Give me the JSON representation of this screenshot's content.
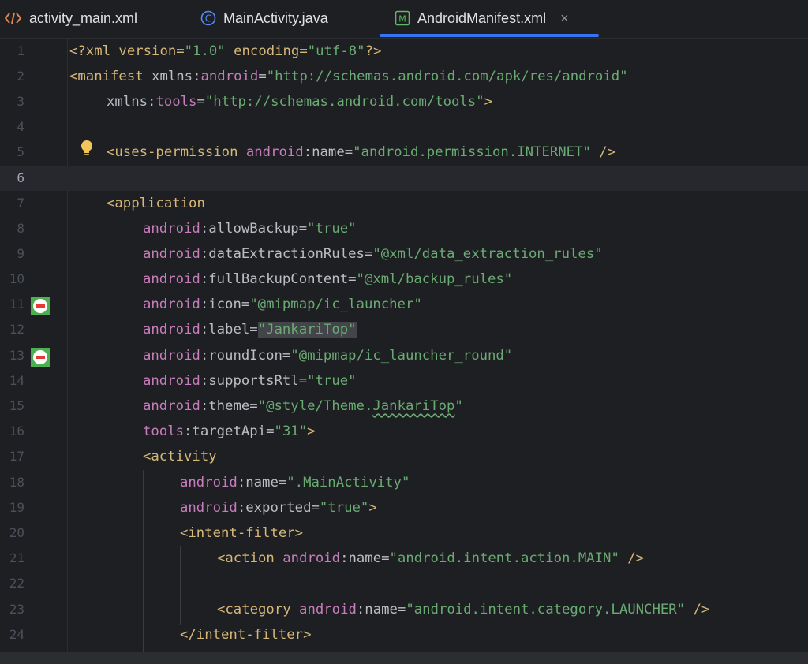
{
  "tabs": [
    {
      "label": "activity_main.xml",
      "icon": "xml-layout-icon"
    },
    {
      "label": "MainActivity.java",
      "icon": "java-class-icon"
    },
    {
      "label": "AndroidManifest.xml",
      "icon": "manifest-icon",
      "active": true,
      "close": "×"
    }
  ],
  "colors": {
    "background": "#1e1f22",
    "tag": "#d5b778",
    "namespace": "#c77dbb",
    "string": "#6aab73",
    "text": "#bcbec4",
    "accent": "#3574f0"
  },
  "current_line": 6,
  "lines": [
    {
      "n": "1"
    },
    {
      "n": "2"
    },
    {
      "n": "3"
    },
    {
      "n": "4"
    },
    {
      "n": "5"
    },
    {
      "n": "6"
    },
    {
      "n": "7"
    },
    {
      "n": "8"
    },
    {
      "n": "9"
    },
    {
      "n": "10"
    },
    {
      "n": "11"
    },
    {
      "n": "12"
    },
    {
      "n": "13"
    },
    {
      "n": "14"
    },
    {
      "n": "15"
    },
    {
      "n": "16"
    },
    {
      "n": "17"
    },
    {
      "n": "18"
    },
    {
      "n": "19"
    },
    {
      "n": "20"
    },
    {
      "n": "21"
    },
    {
      "n": "22"
    },
    {
      "n": "23"
    },
    {
      "n": "24"
    }
  ],
  "code": {
    "l1": {
      "decl": "<?xml version=",
      "v1": "\"1.0\"",
      "mid": " encoding=",
      "v2": "\"utf-8\"",
      "end": "?>"
    },
    "l2": {
      "tag": "<manifest",
      "attr": " xmlns:",
      "ns": "android",
      "eq": "=",
      "val": "\"http://schemas.android.com/apk/res/android\""
    },
    "l3": {
      "attr": "xmlns:",
      "ns": "tools",
      "eq": "=",
      "val": "\"http://schemas.android.com/tools\"",
      "end": ">"
    },
    "l5": {
      "tag": "<uses-permission",
      "ns": "android",
      "attr": ":name=",
      "val": "\"android.permission.INTERNET\"",
      "end": " />"
    },
    "l7": {
      "tag": "<application"
    },
    "l8": {
      "ns": "android",
      "attr": ":allowBackup=",
      "val": "\"true\""
    },
    "l9": {
      "ns": "android",
      "attr": ":dataExtractionRules=",
      "val": "\"@xml/data_extraction_rules\""
    },
    "l10": {
      "ns": "android",
      "attr": ":fullBackupContent=",
      "val": "\"@xml/backup_rules\""
    },
    "l11": {
      "ns": "android",
      "attr": ":icon=",
      "val": "\"@mipmap/ic_launcher\""
    },
    "l12": {
      "ns": "android",
      "attr": ":label=",
      "val": "\"JankariTop\""
    },
    "l13": {
      "ns": "android",
      "attr": ":roundIcon=",
      "val": "\"@mipmap/ic_launcher_round\""
    },
    "l14": {
      "ns": "android",
      "attr": ":supportsRtl=",
      "val": "\"true\""
    },
    "l15": {
      "ns": "android",
      "attr": ":theme=",
      "val1": "\"@style/Theme.",
      "val2": "JankariTop",
      "val3": "\""
    },
    "l16": {
      "ns": "tools",
      "attr": ":targetApi=",
      "val": "\"31\"",
      "end": ">"
    },
    "l17": {
      "tag": "<activity"
    },
    "l18": {
      "ns": "android",
      "attr": ":name=",
      "val": "\".MainActivity\""
    },
    "l19": {
      "ns": "android",
      "attr": ":exported=",
      "val": "\"true\"",
      "end": ">"
    },
    "l20": {
      "tag": "<intent-filter>"
    },
    "l21": {
      "tag": "<action",
      "ns": "android",
      "attr": ":name=",
      "val": "\"android.intent.action.MAIN\"",
      "end": " />"
    },
    "l23": {
      "tag": "<category",
      "ns": "android",
      "attr": ":name=",
      "val": "\"android.intent.category.LAUNCHER\"",
      "end": " />"
    },
    "l24": {
      "tag": "</intent-filter>"
    }
  }
}
